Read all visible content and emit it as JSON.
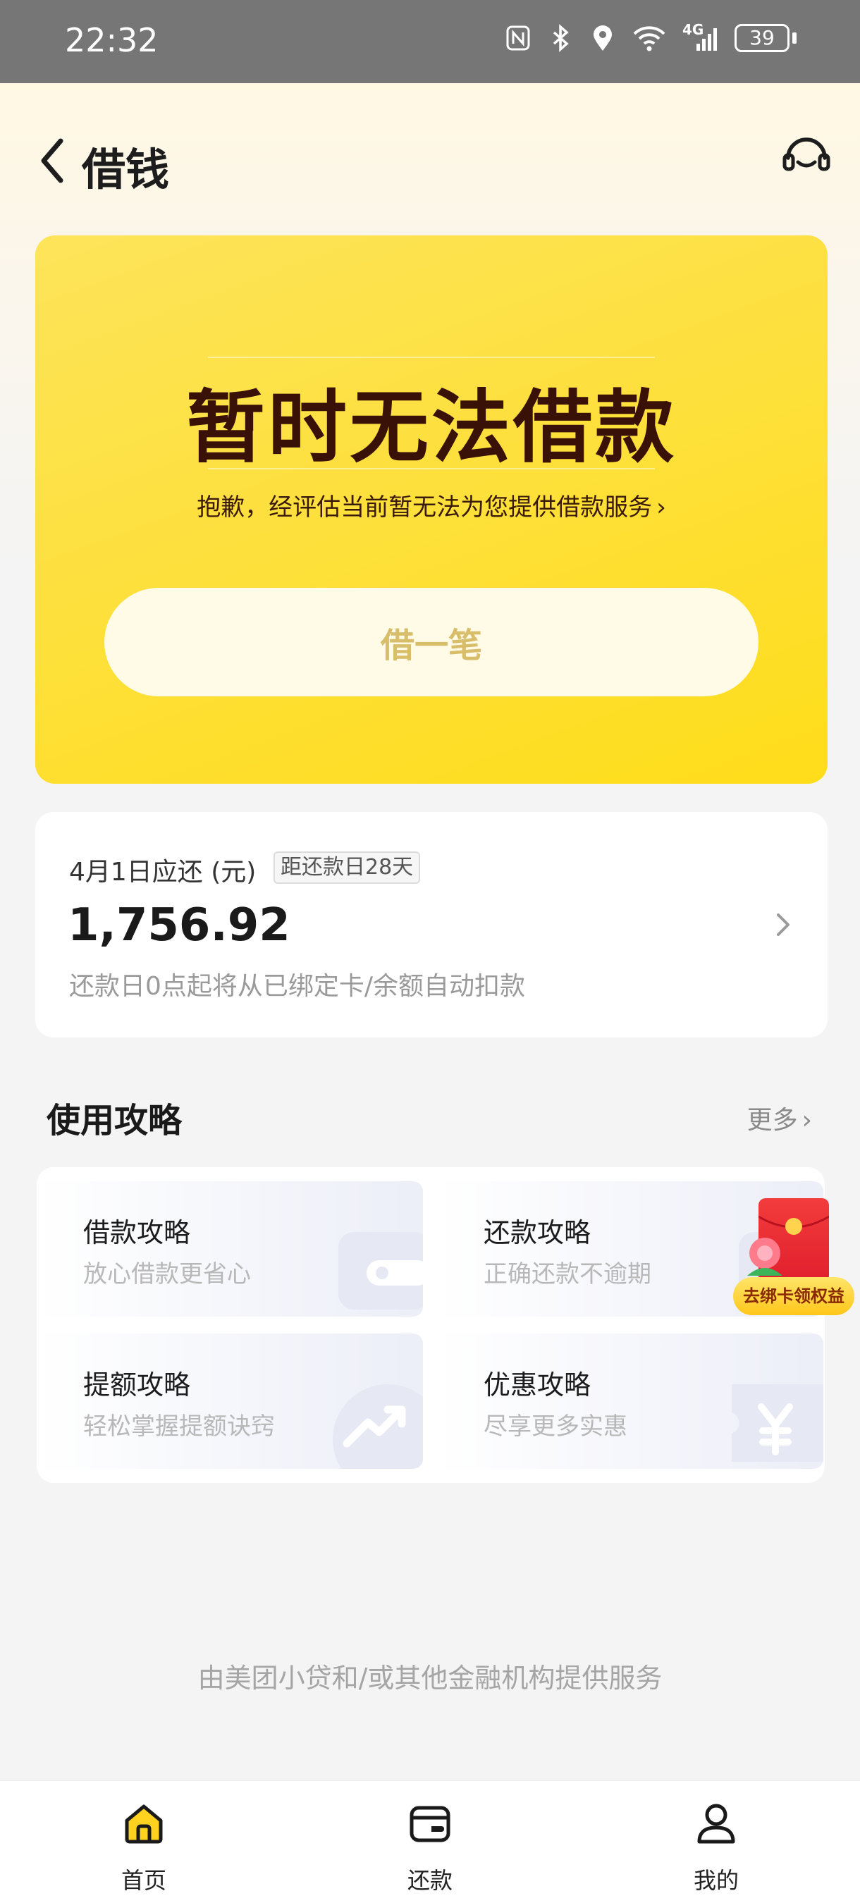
{
  "status_bar": {
    "time": "22:32",
    "network": "4G",
    "battery": "39",
    "icons": [
      "nfc-icon",
      "bluetooth-icon",
      "location-icon",
      "wifi-icon",
      "signal-icon",
      "battery-icon"
    ]
  },
  "header": {
    "title": "借钱",
    "back_icon": "chevron-left-icon",
    "service_icon": "headset-icon"
  },
  "hero": {
    "headline": "暂时无法借款",
    "subtext": "抱歉，经评估当前暂无法为您提供借款服务",
    "subtext_arrow": "›",
    "button_label": "借一笔"
  },
  "repayment": {
    "due_label": "4月1日应还 (元)",
    "days_badge": "距还款日28天",
    "amount": "1,756.92",
    "note": "还款日0点起将从已绑定卡/余额自动扣款"
  },
  "guides": {
    "title": "使用攻略",
    "more_label": "更多",
    "more_arrow": "›",
    "items": [
      {
        "title": "借款攻略",
        "subtitle": "放心借款更省心",
        "icon": "wallet-icon"
      },
      {
        "title": "还款攻略",
        "subtitle": "正确还款不逾期",
        "icon": "calendar-icon"
      },
      {
        "title": "提额攻略",
        "subtitle": "轻松掌握提额诀窍",
        "icon": "trend-up-icon"
      },
      {
        "title": "优惠攻略",
        "subtitle": "尽享更多实惠",
        "icon": "coupon-yuan-icon"
      }
    ]
  },
  "promo": {
    "label": "去绑卡领权益",
    "icon": "red-envelope-icon"
  },
  "footer_note": "由美团小贷和/或其他金融机构提供服务",
  "tabs": [
    {
      "label": "首页",
      "icon": "home-icon",
      "active": true
    },
    {
      "label": "还款",
      "icon": "wallet-card-icon",
      "active": false
    },
    {
      "label": "我的",
      "icon": "user-icon",
      "active": false
    }
  ],
  "colors": {
    "hero_yellow": "#fde03d",
    "headline_brown": "#3a1106",
    "button_text": "#d8bd6a",
    "active_tab_fill": "#ffd21f"
  }
}
